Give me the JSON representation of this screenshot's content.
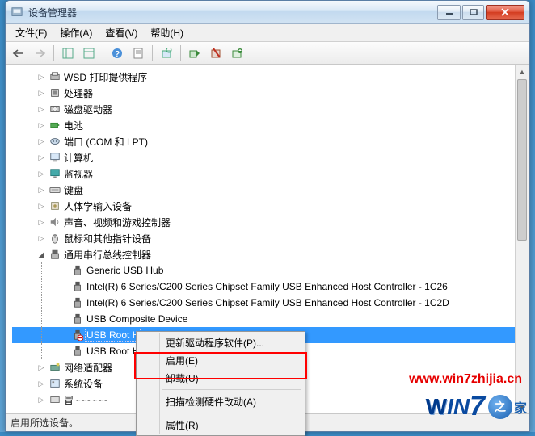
{
  "window": {
    "title": "设备管理器"
  },
  "menubar": {
    "file": "文件(F)",
    "action": "操作(A)",
    "view": "查看(V)",
    "help": "帮助(H)"
  },
  "tree": {
    "wsd": "WSD 打印提供程序",
    "cpu": "处理器",
    "disk": "磁盘驱动器",
    "battery": "电池",
    "ports": "端口 (COM 和 LPT)",
    "computer": "计算机",
    "monitor": "监视器",
    "keyboard": "键盘",
    "hid": "人体学输入设备",
    "sound": "声音、视频和游戏控制器",
    "mouse": "鼠标和其他指针设备",
    "usb": "通用串行总线控制器",
    "usb_children": {
      "generic_hub": "Generic USB Hub",
      "intel_1c26": "Intel(R) 6 Series/C200 Series Chipset Family USB Enhanced Host Controller - 1C26",
      "intel_1c2d": "Intel(R) 6 Series/C200 Series Chipset Family USB Enhanced Host Controller - 1C2D",
      "composite": "USB Composite Device",
      "root_hub_sel": "USB Root H",
      "root_hub2": "USB Root H"
    },
    "network": "网络适配器",
    "system": "系统设备",
    "partial": "冒~~~~~~"
  },
  "context_menu": {
    "update_driver": "更新驱动程序软件(P)...",
    "enable": "启用(E)",
    "uninstall": "卸载(U)",
    "scan": "扫描检测硬件改动(A)",
    "properties": "属性(R)"
  },
  "statusbar": {
    "text": "启用所选设备。"
  },
  "watermark": {
    "url": "www.win7zhijia.cn"
  },
  "logo": {
    "brand_w": "W",
    "brand_in": "IN",
    "brand_7": "7",
    "tail": "家",
    "dot": "之"
  }
}
